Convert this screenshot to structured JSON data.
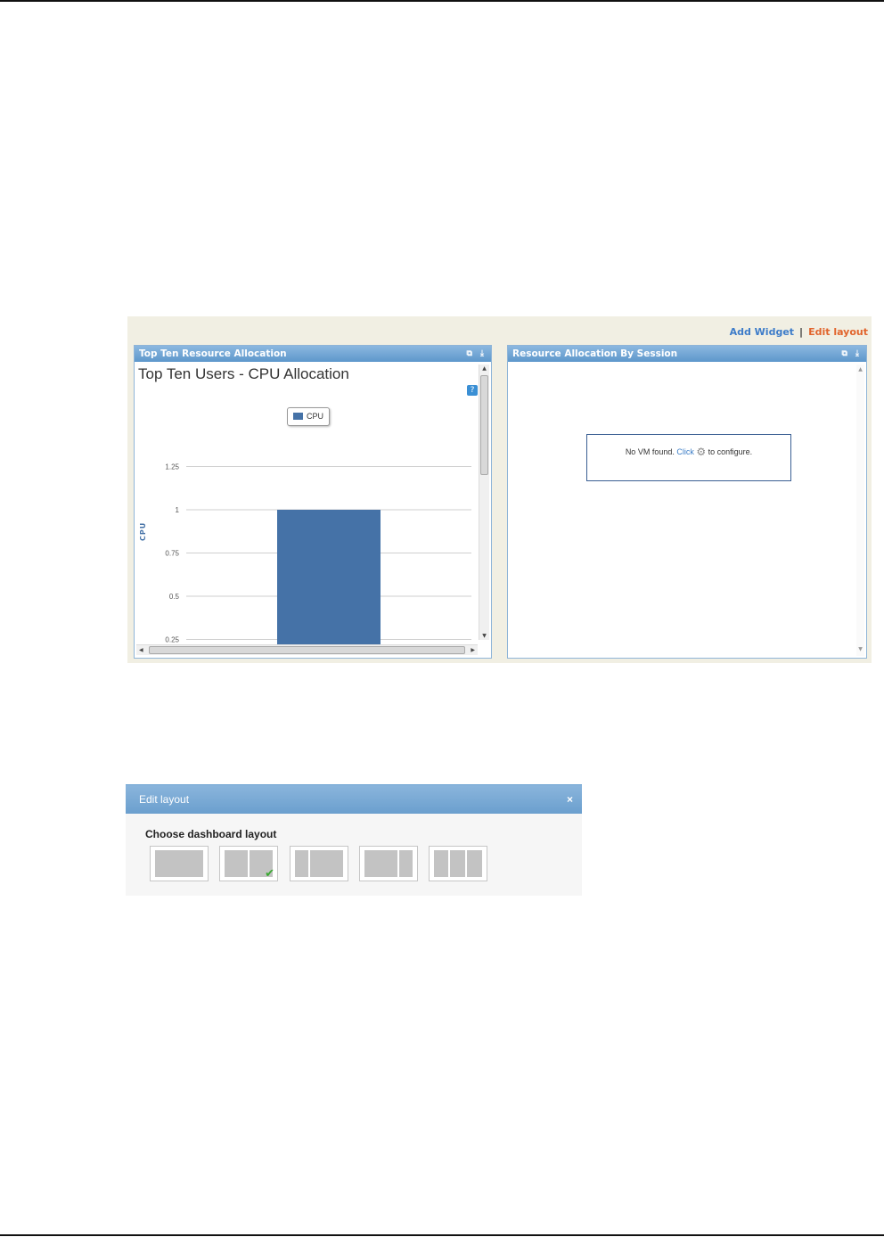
{
  "dashboard": {
    "add_widget_label": "Add Widget",
    "separator": "|",
    "edit_layout_label": "Edit layout"
  },
  "widget_left": {
    "title": "Top Ten Resource Allocation",
    "tools": "⧉ ⤓"
  },
  "widget_right": {
    "title": "Resource Allocation By Session",
    "tools": "⧉ ⤓",
    "message_pre": "No VM found.",
    "message_click": "Click",
    "message_post": "to configure."
  },
  "chart_data": {
    "type": "bar",
    "title": "Top Ten Users - CPU Allocation",
    "ylabel": "CPU",
    "legend": [
      "CPU"
    ],
    "series": [
      {
        "name": "CPU",
        "values": [
          1
        ]
      }
    ],
    "categories": [
      ""
    ],
    "ylim": [
      0,
      1.25
    ],
    "yticks": [
      "1.25",
      "1",
      "0.75",
      "0.5",
      "0.25"
    ],
    "color": "#4572a7",
    "help_label": "?"
  },
  "edit_layout_dialog": {
    "title": "Edit layout",
    "close_label": "×",
    "section_title": "Choose dashboard layout",
    "selected_option": 2
  }
}
